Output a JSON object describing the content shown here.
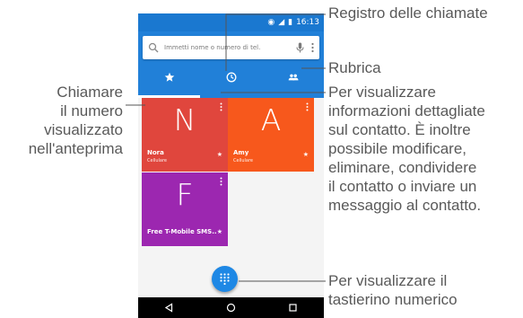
{
  "status_bar": {
    "time": "16:13"
  },
  "search": {
    "placeholder": "Immetti nome o numero di tel."
  },
  "tabs": [
    {
      "icon": "star-icon",
      "active": true
    },
    {
      "icon": "clock-icon",
      "active": false
    },
    {
      "icon": "people-icon",
      "active": false
    }
  ],
  "contacts": [
    {
      "letter": "N",
      "name": "Nora",
      "type": "Cellulare",
      "color": "#e0463d"
    },
    {
      "letter": "A",
      "name": "Amy",
      "type": "Cellulare",
      "color": "#f7581c"
    },
    {
      "letter": "F",
      "name": "Free T-Mobile SMS..",
      "color": "#9c27b0"
    }
  ],
  "annotations": {
    "registro": "Registro delle chiamate",
    "rubrica": "Rubrica",
    "dettagli": "Per visualizzare informazioni dettagliate sul contatto. È inoltre possibile modificare, eliminare, condividere il contatto o inviare un messaggio al contatto.",
    "dettagli_lines": [
      "Per visualizzare",
      "informazioni dettagliate",
      "sul contatto. È inoltre",
      "possibile modificare,",
      "eliminare, condividere",
      "il contatto o inviare un",
      "messaggio al contatto."
    ],
    "chiamare_lines": [
      "Chiamare",
      "il numero",
      "visualizzato",
      "nell'anteprima"
    ],
    "tastiera_lines": [
      "Per visualizzare il",
      "tastierino numerico"
    ]
  },
  "colors": {
    "primary": "#2180d8",
    "status_bar": "#1a78d0",
    "annotation_text": "#595959"
  }
}
